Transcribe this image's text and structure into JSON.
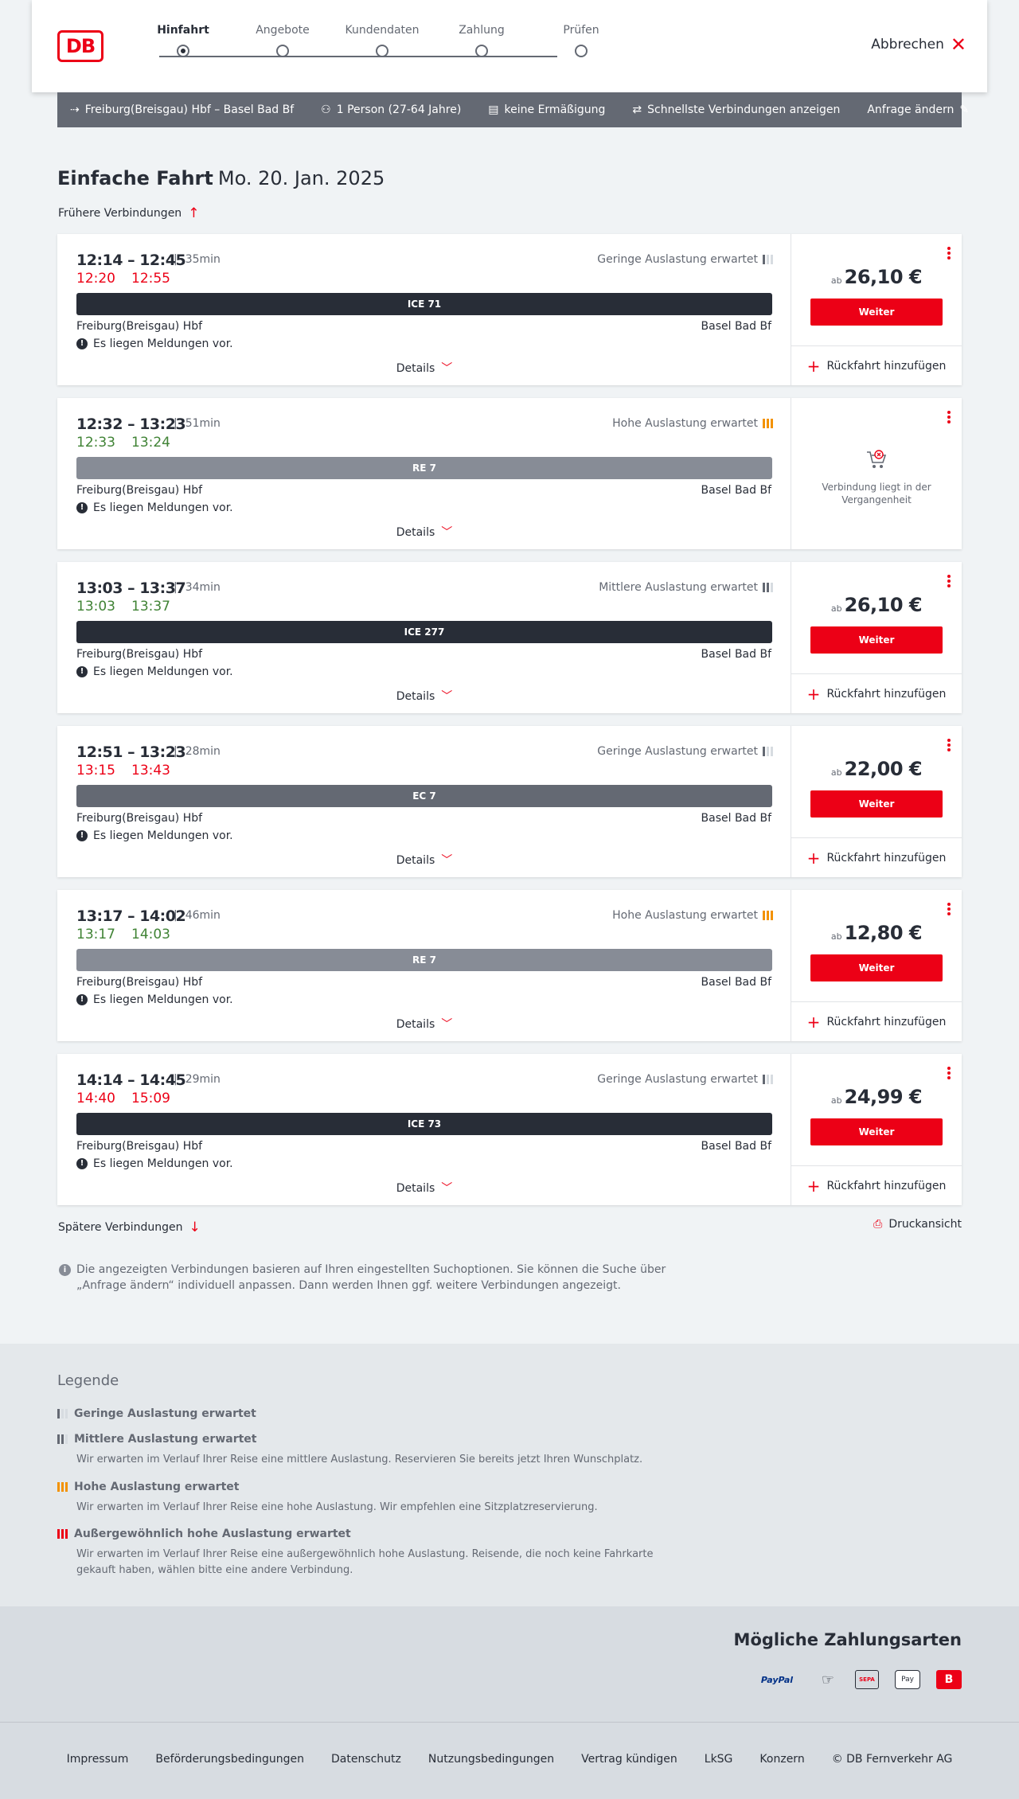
{
  "header": {
    "logo": "DB",
    "steps": [
      {
        "label": "Hinfahrt",
        "active": true
      },
      {
        "label": "Angebote",
        "active": false
      },
      {
        "label": "Kundendaten",
        "active": false
      },
      {
        "label": "Zahlung",
        "active": false
      },
      {
        "label": "Prüfen",
        "active": false
      }
    ],
    "cancel_label": "Abbrechen"
  },
  "query": {
    "route": "Freiburg(Breisgau) Hbf – Basel Bad Bf",
    "travellers": "1 Person (27-64 Jahre)",
    "discount": "keine Ermäßigung",
    "option": "Schnellste Verbindungen anzeigen",
    "change_label": "Anfrage ändern"
  },
  "title": {
    "trip_type": "Einfache Fahrt",
    "date": "Mo. 20. Jan. 2025"
  },
  "earlier_label": "Frühere Verbindungen",
  "later_label": "Spätere Verbindungen",
  "print_label": "Druckansicht",
  "connections": [
    {
      "times": "12:14 – 12:45",
      "duration": "35min",
      "rt_dep": "12:20",
      "rt_arr": "12:55",
      "rt_status": "late",
      "load": "Geringe Auslastung erwartet",
      "load_level": "low",
      "train": "ICE 71",
      "train_type": "ice",
      "from": "Freiburg(Breisgau) Hbf",
      "to": "Basel Bad Bf",
      "message": "Es liegen Meldungen vor.",
      "details": "Details",
      "price_prefix": "ab",
      "price": "26,10 €",
      "weiter": "Weiter",
      "return": "Rückfahrt hinzufügen",
      "past": false,
      "past_text": ""
    },
    {
      "times": "12:32 – 13:23",
      "duration": "51min",
      "rt_dep": "12:33",
      "rt_arr": "13:24",
      "rt_status": "ok",
      "load": "Hohe Auslastung erwartet",
      "load_level": "high",
      "train": "RE 7",
      "train_type": "re",
      "from": "Freiburg(Breisgau) Hbf",
      "to": "Basel Bad Bf",
      "message": "Es liegen Meldungen vor.",
      "details": "Details",
      "price_prefix": "",
      "price": "",
      "weiter": "",
      "return": "",
      "past": true,
      "past_text": "Verbindung liegt in der Vergangenheit"
    },
    {
      "times": "13:03 – 13:37",
      "duration": "34min",
      "rt_dep": "13:03",
      "rt_arr": "13:37",
      "rt_status": "ok",
      "load": "Mittlere Auslastung erwartet",
      "load_level": "mid",
      "train": "ICE 277",
      "train_type": "ice",
      "from": "Freiburg(Breisgau) Hbf",
      "to": "Basel Bad Bf",
      "message": "Es liegen Meldungen vor.",
      "details": "Details",
      "price_prefix": "ab",
      "price": "26,10 €",
      "weiter": "Weiter",
      "return": "Rückfahrt hinzufügen",
      "past": false,
      "past_text": ""
    },
    {
      "times": "12:51 – 13:23",
      "duration": "28min",
      "rt_dep": "13:15",
      "rt_arr": "13:43",
      "rt_status": "late",
      "load": "Geringe Auslastung erwartet",
      "load_level": "low",
      "train": "EC 7",
      "train_type": "ec",
      "from": "Freiburg(Breisgau) Hbf",
      "to": "Basel Bad Bf",
      "message": "Es liegen Meldungen vor.",
      "details": "Details",
      "price_prefix": "ab",
      "price": "22,00 €",
      "weiter": "Weiter",
      "return": "Rückfahrt hinzufügen",
      "past": false,
      "past_text": ""
    },
    {
      "times": "13:17 – 14:02",
      "duration": "46min",
      "rt_dep": "13:17",
      "rt_arr": "14:03",
      "rt_status": "ok",
      "load": "Hohe Auslastung erwartet",
      "load_level": "high",
      "train": "RE 7",
      "train_type": "re",
      "from": "Freiburg(Breisgau) Hbf",
      "to": "Basel Bad Bf",
      "message": "Es liegen Meldungen vor.",
      "details": "Details",
      "price_prefix": "ab",
      "price": "12,80 €",
      "weiter": "Weiter",
      "return": "Rückfahrt hinzufügen",
      "past": false,
      "past_text": ""
    },
    {
      "times": "14:14 – 14:45",
      "duration": "29min",
      "rt_dep": "14:40",
      "rt_arr": "15:09",
      "rt_status": "late",
      "load": "Geringe Auslastung erwartet",
      "load_level": "low",
      "train": "ICE 73",
      "train_type": "ice",
      "from": "Freiburg(Breisgau) Hbf",
      "to": "Basel Bad Bf",
      "message": "Es liegen Meldungen vor.",
      "details": "Details",
      "price_prefix": "ab",
      "price": "24,99 €",
      "weiter": "Weiter",
      "return": "Rückfahrt hinzufügen",
      "past": false,
      "past_text": ""
    }
  ],
  "info_text": "Die angezeigten Verbindungen basieren auf Ihren eingestellten Suchoptionen. Sie können die Suche über „Anfrage ändern“ individuell anpassen. Dann werden Ihnen ggf. weitere Verbindungen angezeigt.",
  "legend": {
    "title": "Legende",
    "items": [
      {
        "title": "Geringe Auslastung erwartet",
        "level": "low",
        "desc": ""
      },
      {
        "title": "Mittlere Auslastung erwartet",
        "level": "mid",
        "desc": "Wir erwarten im Verlauf Ihrer Reise eine mittlere Auslastung. Reservieren Sie bereits jetzt Ihren Wunschplatz."
      },
      {
        "title": "Hohe Auslastung erwartet",
        "level": "high",
        "desc": "Wir erwarten im Verlauf Ihrer Reise eine hohe Auslastung. Wir empfehlen eine Sitzplatzreservierung."
      },
      {
        "title": "Außergewöhnlich hohe Auslastung erwartet",
        "level": "extreme",
        "desc": "Wir erwarten im Verlauf Ihrer Reise eine außergewöhnlich hohe Auslastung. Reisende, die noch keine Fahrkarte gekauft haben, wählen bitte eine andere Verbindung."
      }
    ]
  },
  "payment": {
    "title": "Mögliche Zahlungsarten",
    "methods": [
      {
        "name": "paypal-icon",
        "label": "PayPal"
      },
      {
        "name": "credit-card-hand-icon",
        "label": ""
      },
      {
        "name": "sepa-icon",
        "label": "SEPA"
      },
      {
        "name": "apple-pay-icon",
        "label": "Pay"
      },
      {
        "name": "db-pay-icon",
        "label": "B"
      }
    ]
  },
  "footer": {
    "links": [
      "Impressum",
      "Beförderungsbedingungen",
      "Datenschutz",
      "Nutzungsbedingungen",
      "Vertrag kündigen",
      "LkSG",
      "Konzern",
      "© DB Fernverkehr AG"
    ]
  },
  "colors": {
    "brand_red": "#ec0016",
    "delay_red": "#ec0016",
    "ontime_green": "#408335",
    "high_load_orange": "#f39200",
    "dark": "#282d37"
  }
}
